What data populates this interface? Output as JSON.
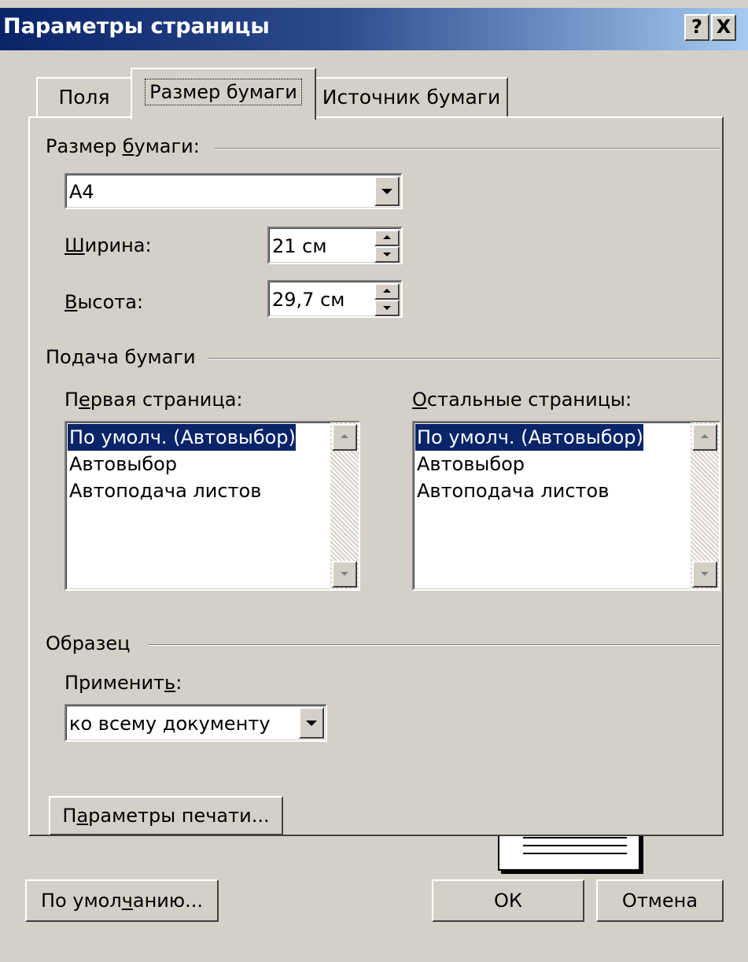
{
  "dialog": {
    "title": "Параметры страницы",
    "help_label": "?",
    "close_label": "X"
  },
  "tabs": {
    "fields": "Поля",
    "paper_size": "Размер бумаги",
    "paper_source": "Источник бумаги"
  },
  "paper_size": {
    "group_label_pre": "Размер ",
    "group_label_u": "б",
    "group_label_post": "умаги:",
    "selected": "А4",
    "width_label_u": "Ш",
    "width_label_post": "ирина:",
    "width_value": "21 см",
    "height_label_u": "В",
    "height_label_post": "ысота:",
    "height_value": "29,7 см"
  },
  "paper_feed": {
    "group_label": "Подача бумаги",
    "first_label_pre": "П",
    "first_label_u": "е",
    "first_label_post": "рвая страница:",
    "other_label_u": "О",
    "other_label_post": "стальные страницы:",
    "first_items": [
      "По умолч. (Автовыбор)",
      "Автовыбор",
      "Автоподача листов"
    ],
    "other_items": [
      "По умолч. (Автовыбор)",
      "Автовыбор",
      "Автоподача листов"
    ]
  },
  "sample": {
    "group_label": "Образец",
    "apply_label_pre": "Применит",
    "apply_label_u": "ь",
    "apply_label_post": ":",
    "apply_value": "ко всему документу"
  },
  "buttons": {
    "print_options_pre": "П",
    "print_options_u": "а",
    "print_options_post": "раметры печати...",
    "default_pre": "По умол",
    "default_u": "ч",
    "default_post": "анию...",
    "ok": "ОК",
    "cancel": "Отмена"
  },
  "colors": {
    "title_bar_start": "#0a246a",
    "title_bar_end": "#a6caf0",
    "selection": "#0a246a",
    "face": "#d4d0c8"
  }
}
